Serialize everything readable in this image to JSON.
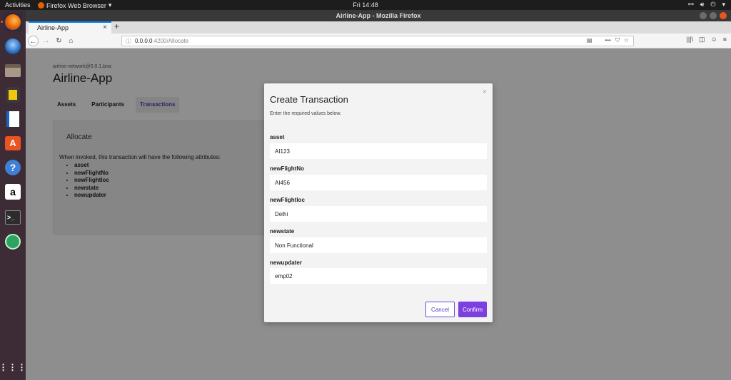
{
  "topbar": {
    "activities": "Activities",
    "app_menu": "Firefox Web Browser",
    "clock": "Fri 14:48"
  },
  "window": {
    "title": "Airline-App - Mozilla Firefox"
  },
  "browser": {
    "tab_title": "Airline-App",
    "url_host": "0.0.0.0",
    "url_path": ":4200/Allocate"
  },
  "page": {
    "network": "airline-network@0.0.1.bna",
    "title": "Airline-App",
    "tabs": [
      {
        "label": "Assets"
      },
      {
        "label": "Participants"
      },
      {
        "label": "Transactions"
      }
    ],
    "panel_title": "Allocate",
    "panel_desc": "When invoked, this transaction will have the following attributes:",
    "attributes": [
      "asset",
      "newFlightNo",
      "newFlightloc",
      "newstate",
      "newupdater"
    ]
  },
  "modal": {
    "title": "Create Transaction",
    "subtitle": "Enter the required values below.",
    "fields": [
      {
        "label": "asset",
        "value": "AI123"
      },
      {
        "label": "newFlightNo",
        "value": "AI456"
      },
      {
        "label": "newFlightloc",
        "value": "Delhi"
      },
      {
        "label": "newstate",
        "value": "Non Functional"
      },
      {
        "label": "newupdater",
        "value": "emp02"
      }
    ],
    "cancel": "Cancel",
    "confirm": "Confirm"
  },
  "colors": {
    "accent": "#7d3fe0",
    "dock": "#3d2b36",
    "topbar": "#1d1d1d"
  }
}
